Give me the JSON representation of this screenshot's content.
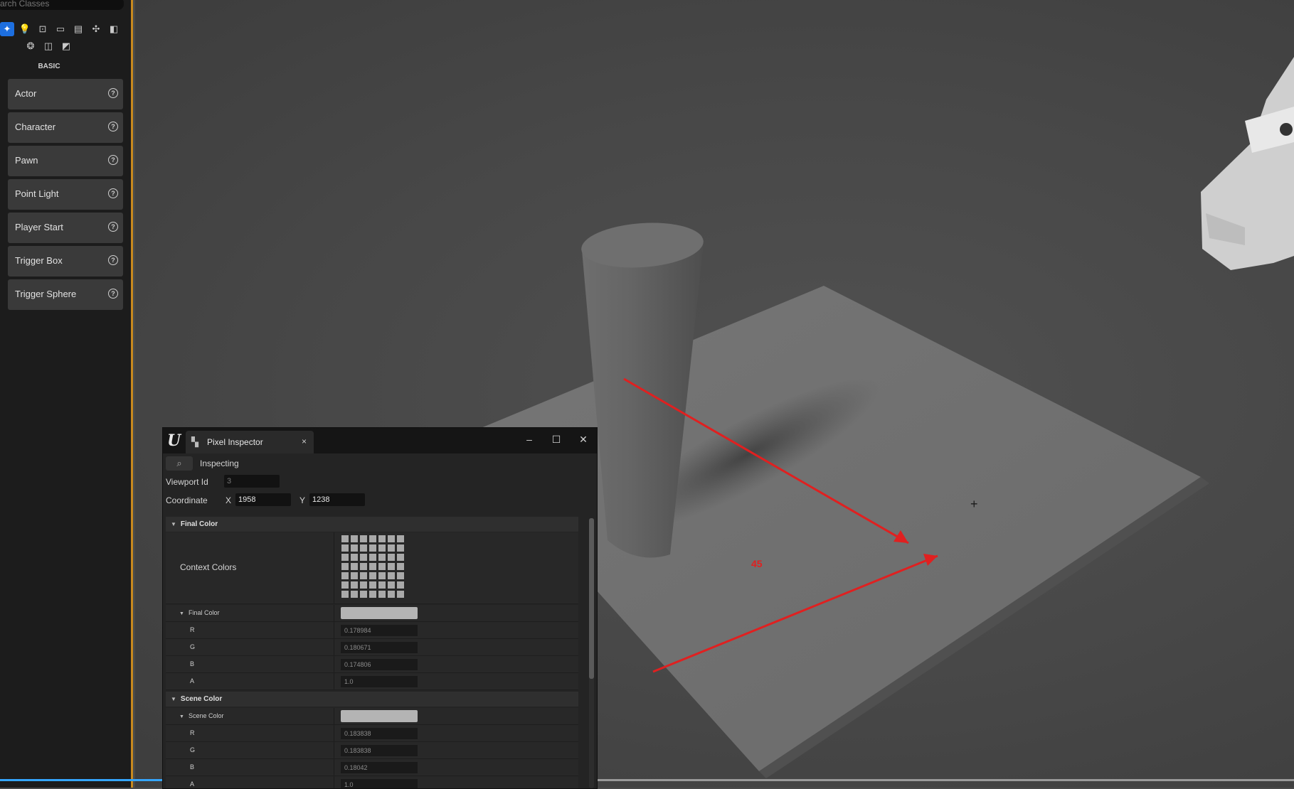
{
  "left_panel": {
    "search_placeholder": "arch Classes",
    "category_icons": [
      "get-started-icon",
      "light-icon",
      "character-actor-icon",
      "shapes-icon",
      "cinematic-icon",
      "visual-effects-icon",
      "volumes-icon",
      "all-classes-icon",
      "geometry-icon",
      "recently-placed-icon"
    ],
    "section_title": "BASIC",
    "items": [
      {
        "label": "Actor"
      },
      {
        "label": "Character"
      },
      {
        "label": "Pawn"
      },
      {
        "label": "Point Light"
      },
      {
        "label": "Player Start"
      },
      {
        "label": "Trigger Box"
      },
      {
        "label": "Trigger Sphere"
      }
    ]
  },
  "viewport": {
    "annotation_label": "45",
    "annotation_color": "#e02020",
    "progress_fraction": 0.33
  },
  "inspector": {
    "tab_title": "Pixel Inspector",
    "inspecting_label": "Inspecting",
    "viewport_id_label": "Viewport Id",
    "viewport_id_value": "3",
    "coordinate_label": "Coordinate",
    "x_label": "X",
    "x_value": "1958",
    "y_label": "Y",
    "y_value": "1238",
    "final_color_section": "Final Color",
    "context_colors_label": "Context Colors",
    "final_color_group": "Final Color",
    "final_color": [
      {
        "channel": "R",
        "value": "0.178984"
      },
      {
        "channel": "G",
        "value": "0.180671"
      },
      {
        "channel": "B",
        "value": "0.174806"
      },
      {
        "channel": "A",
        "value": "1.0"
      }
    ],
    "scene_color_section": "Scene Color",
    "scene_color_group": "Scene Color",
    "scene_color": [
      {
        "channel": "R",
        "value": "0.183838"
      },
      {
        "channel": "G",
        "value": "0.183838"
      },
      {
        "channel": "B",
        "value": "0.18042"
      },
      {
        "channel": "A",
        "value": "1.0"
      }
    ]
  }
}
